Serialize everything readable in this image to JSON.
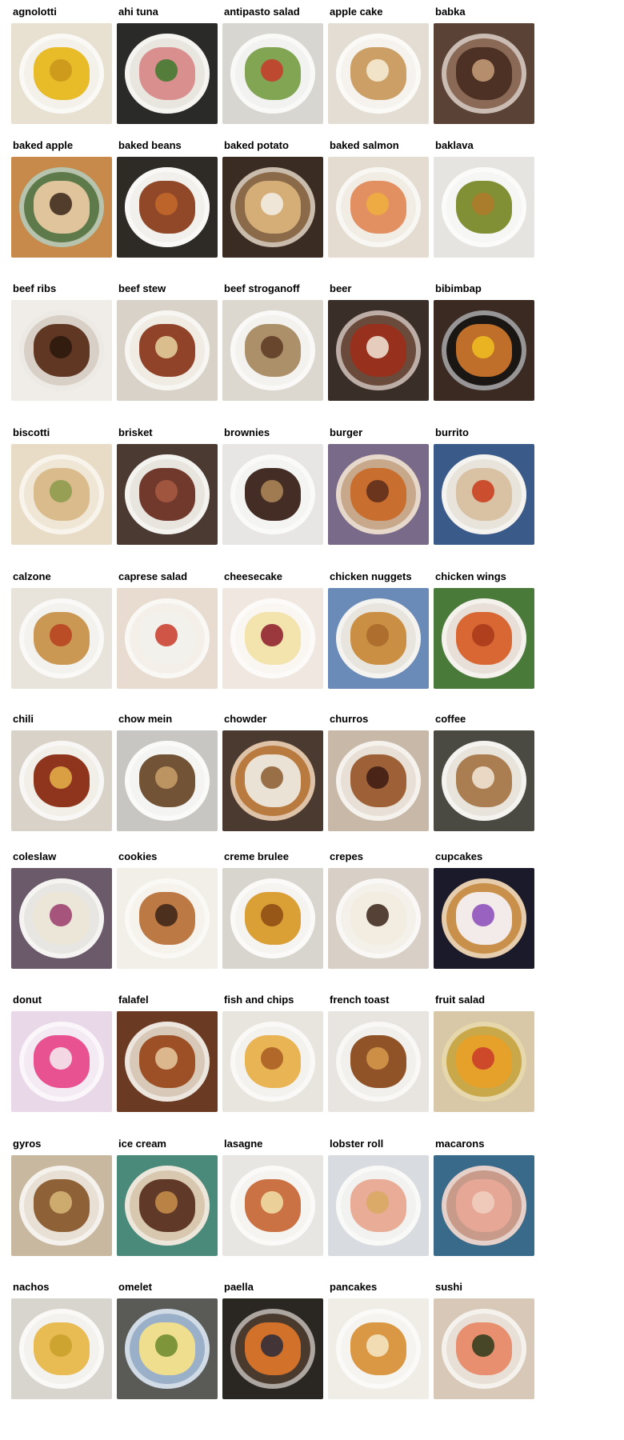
{
  "items": [
    {
      "label": "agnolotti",
      "icon": "food-photo-agnolotti",
      "bg": "#e8e0d0",
      "plate": "#f4f1ea",
      "food": "#e6b81e",
      "accent": "#c9951a"
    },
    {
      "label": "ahi tuna",
      "icon": "food-photo-ahi-tuna",
      "bg": "#2a2a28",
      "plate": "#e9e6df",
      "food": "#d98a8a",
      "accent": "#3c7a2e"
    },
    {
      "label": "antipasto salad",
      "icon": "food-photo-antipasto-salad",
      "bg": "#d8d6d0",
      "plate": "#f2f2f0",
      "food": "#7aa04a",
      "accent": "#c83a2a"
    },
    {
      "label": "apple cake",
      "icon": "food-photo-apple-cake",
      "bg": "#e3ddd4",
      "plate": "#f6f3ee",
      "food": "#c99a5e",
      "accent": "#f6efd8"
    },
    {
      "label": "babka",
      "icon": "food-photo-babka",
      "bg": "#5a4236",
      "plate": "#8a6a56",
      "food": "#4a2e22",
      "accent": "#c8a07a"
    },
    {
      "label": "baked apple",
      "icon": "food-photo-baked-apple",
      "bg": "#c88a4a",
      "plate": "#5f7a4a",
      "food": "#e6c8a0",
      "accent": "#3a2418"
    },
    {
      "label": "baked beans",
      "icon": "food-photo-baked-beans",
      "bg": "#2e2a26",
      "plate": "#f2f0ec",
      "food": "#8a3e1e",
      "accent": "#c46a2a"
    },
    {
      "label": "baked potato",
      "icon": "food-photo-baked-potato",
      "bg": "#3a2c22",
      "plate": "#8a6a48",
      "food": "#d9b27a",
      "accent": "#f4f0e8"
    },
    {
      "label": "baked salmon",
      "icon": "food-photo-baked-salmon",
      "bg": "#e4dcd0",
      "plate": "#f2ede4",
      "food": "#e08a5a",
      "accent": "#f0b040"
    },
    {
      "label": "baklava",
      "icon": "food-photo-baklava",
      "bg": "#e6e4e0",
      "plate": "#f6f6f4",
      "food": "#7a8a2a",
      "accent": "#b07a2a"
    },
    {
      "label": "beef ribs",
      "icon": "food-photo-beef-ribs",
      "bg": "#f0ede8",
      "plate": "#d8d0c6",
      "food": "#5a2e1a",
      "accent": "#2a160c"
    },
    {
      "label": "beef stew",
      "icon": "food-photo-beef-stew",
      "bg": "#d8d2c8",
      "plate": "#f0ece4",
      "food": "#8a3a1e",
      "accent": "#e8d4a0"
    },
    {
      "label": "beef stroganoff",
      "icon": "food-photo-beef-stroganoff",
      "bg": "#dcd8d0",
      "plate": "#f4f2ee",
      "food": "#a88a62",
      "accent": "#5a3a22"
    },
    {
      "label": "beer",
      "icon": "food-photo-beer",
      "bg": "#3a2e28",
      "plate": "#6a4a3a",
      "food": "#9a2e1a",
      "accent": "#f2e8d8"
    },
    {
      "label": "bibimbap",
      "icon": "food-photo-bibimbap",
      "bg": "#3a2a22",
      "plate": "#1a1614",
      "food": "#c8742a",
      "accent": "#f0c020"
    },
    {
      "label": "biscotti",
      "icon": "food-photo-biscotti",
      "bg": "#e8dcc6",
      "plate": "#efe6d6",
      "food": "#d8b888",
      "accent": "#8a9a4a"
    },
    {
      "label": "brisket",
      "icon": "food-photo-brisket",
      "bg": "#4a3a32",
      "plate": "#e8e4de",
      "food": "#6a2e22",
      "accent": "#a85a42"
    },
    {
      "label": "brownies",
      "icon": "food-photo-brownies",
      "bg": "#e8e6e4",
      "plate": "#f4f4f2",
      "food": "#3a2218",
      "accent": "#b08a5a"
    },
    {
      "label": "burger",
      "icon": "food-photo-burger",
      "bg": "#7a6a8a",
      "plate": "#c8a88a",
      "food": "#c86a2a",
      "accent": "#5a2a1a"
    },
    {
      "label": "burrito",
      "icon": "food-photo-burrito",
      "bg": "#3a5a8a",
      "plate": "#e8e4dc",
      "food": "#d8c0a0",
      "accent": "#c83a1a"
    },
    {
      "label": "calzone",
      "icon": "food-photo-calzone",
      "bg": "#e8e4dc",
      "plate": "#f4f2ee",
      "food": "#c8924a",
      "accent": "#b8401e"
    },
    {
      "label": "caprese salad",
      "icon": "food-photo-caprese-salad",
      "bg": "#e8dcd0",
      "plate": "#f4efe8",
      "food": "#f2f0ec",
      "accent": "#c83a2a"
    },
    {
      "label": "cheesecake",
      "icon": "food-photo-cheesecake",
      "bg": "#f0e8e0",
      "plate": "#faf6f2",
      "food": "#f2e2a8",
      "accent": "#8a1a2a"
    },
    {
      "label": "chicken nuggets",
      "icon": "food-photo-chicken-nuggets",
      "bg": "#6a8ab8",
      "plate": "#e8e4de",
      "food": "#c88a3a",
      "accent": "#a8682a"
    },
    {
      "label": "chicken wings",
      "icon": "food-photo-chicken-wings",
      "bg": "#4a7a3a",
      "plate": "#e8e0d8",
      "food": "#d8602a",
      "accent": "#a83a1a"
    },
    {
      "label": "chili",
      "icon": "food-photo-chili",
      "bg": "#d8d2c8",
      "plate": "#f2eee8",
      "food": "#8a2a12",
      "accent": "#e8b04a"
    },
    {
      "label": "chow mein",
      "icon": "food-photo-chow-mein",
      "bg": "#c8c6c2",
      "plate": "#f4f4f2",
      "food": "#6a4a2a",
      "accent": "#c8a06a"
    },
    {
      "label": "chowder",
      "icon": "food-photo-chowder",
      "bg": "#4a3a30",
      "plate": "#b87a3e",
      "food": "#ece8dc",
      "accent": "#8a5a2e"
    },
    {
      "label": "churros",
      "icon": "food-photo-churros",
      "bg": "#c8b8a8",
      "plate": "#e8e0d6",
      "food": "#9a5a2e",
      "accent": "#3a1a12"
    },
    {
      "label": "coffee",
      "icon": "food-photo-coffee",
      "bg": "#4a4a42",
      "plate": "#e8e4dc",
      "food": "#a8784a",
      "accent": "#f2e8d8"
    },
    {
      "label": "coleslaw",
      "icon": "food-photo-coleslaw",
      "bg": "#6a5a6a",
      "plate": "#e8e6e2",
      "food": "#ece6d8",
      "accent": "#9a3a6a"
    },
    {
      "label": "cookies",
      "icon": "food-photo-cookies",
      "bg": "#f2eee8",
      "plate": "#f6f2ec",
      "food": "#b8723a",
      "accent": "#3a2218"
    },
    {
      "label": "creme brulee",
      "icon": "food-photo-creme-brulee",
      "bg": "#d8d4ce",
      "plate": "#f6f4f0",
      "food": "#d89a2a",
      "accent": "#8a4a12"
    },
    {
      "label": "crepes",
      "icon": "food-photo-crepes",
      "bg": "#d8d0c6",
      "plate": "#f4f0ea",
      "food": "#f2ece0",
      "accent": "#3a2218"
    },
    {
      "label": "cupcakes",
      "icon": "food-photo-cupcakes",
      "bg": "#1a1a2a",
      "plate": "#c8904a",
      "food": "#f4f0f2",
      "accent": "#8a4aba"
    },
    {
      "label": "donut",
      "icon": "food-photo-donut",
      "bg": "#e8d8e8",
      "plate": "#f4eaf4",
      "food": "#e84a8a",
      "accent": "#f4f0f2"
    },
    {
      "label": "falafel",
      "icon": "food-photo-falafel",
      "bg": "#6a3a22",
      "plate": "#d8c8b8",
      "food": "#9a4a1e",
      "accent": "#e8c8a0"
    },
    {
      "label": "fish and chips",
      "icon": "food-photo-fish-and-chips",
      "bg": "#e8e4de",
      "plate": "#f4f2ee",
      "food": "#e8b04a",
      "accent": "#a85a22"
    },
    {
      "label": "french toast",
      "icon": "food-photo-french-toast",
      "bg": "#e8e4e0",
      "plate": "#f2f0ec",
      "food": "#8a4a1e",
      "accent": "#d89a4a"
    },
    {
      "label": "fruit salad",
      "icon": "food-photo-fruit-salad",
      "bg": "#d8c8a8",
      "plate": "#c8a848",
      "food": "#e8a02a",
      "accent": "#c83a2a"
    },
    {
      "label": "gyros",
      "icon": "food-photo-gyros",
      "bg": "#c8b8a0",
      "plate": "#e8e0d4",
      "food": "#8a5a2e",
      "accent": "#d8b878"
    },
    {
      "label": "ice cream",
      "icon": "food-photo-ice-cream",
      "bg": "#4a8a7a",
      "plate": "#d8c8b0",
      "food": "#5a3222",
      "accent": "#c8904a"
    },
    {
      "label": "lasagne",
      "icon": "food-photo-lasagne",
      "bg": "#e8e6e2",
      "plate": "#f6f4f0",
      "food": "#c86a3a",
      "accent": "#f2e0a8"
    },
    {
      "label": "lobster roll",
      "icon": "food-photo-lobster-roll",
      "bg": "#d8dce0",
      "plate": "#f2f2f0",
      "food": "#e8a890",
      "accent": "#d8a860"
    },
    {
      "label": "macarons",
      "icon": "food-photo-macarons",
      "bg": "#3a6a8a",
      "plate": "#c89a8a",
      "food": "#e8a898",
      "accent": "#f0d0c0"
    },
    {
      "label": "nachos",
      "icon": "food-photo-nachos",
      "bg": "#d8d4ce",
      "plate": "#f4f2ee",
      "food": "#e8b84a",
      "accent": "#c8a02a"
    },
    {
      "label": "omelet",
      "icon": "food-photo-omelet",
      "bg": "#5a5a56",
      "plate": "#9ab0c8",
      "food": "#f2e08a",
      "accent": "#6a8a2a"
    },
    {
      "label": "paella",
      "icon": "food-photo-paella",
      "bg": "#2a2622",
      "plate": "#4a3a2e",
      "food": "#d8742a",
      "accent": "#2a2a3a"
    },
    {
      "label": "pancakes",
      "icon": "food-photo-pancakes",
      "bg": "#f0ece6",
      "plate": "#f6f4f0",
      "food": "#d8923a",
      "accent": "#f4e8c8"
    },
    {
      "label": "sushi",
      "icon": "food-photo-sushi",
      "bg": "#d8c8b8",
      "plate": "#e8e0d6",
      "food": "#e88a6a",
      "accent": "#2a3a1a"
    }
  ]
}
